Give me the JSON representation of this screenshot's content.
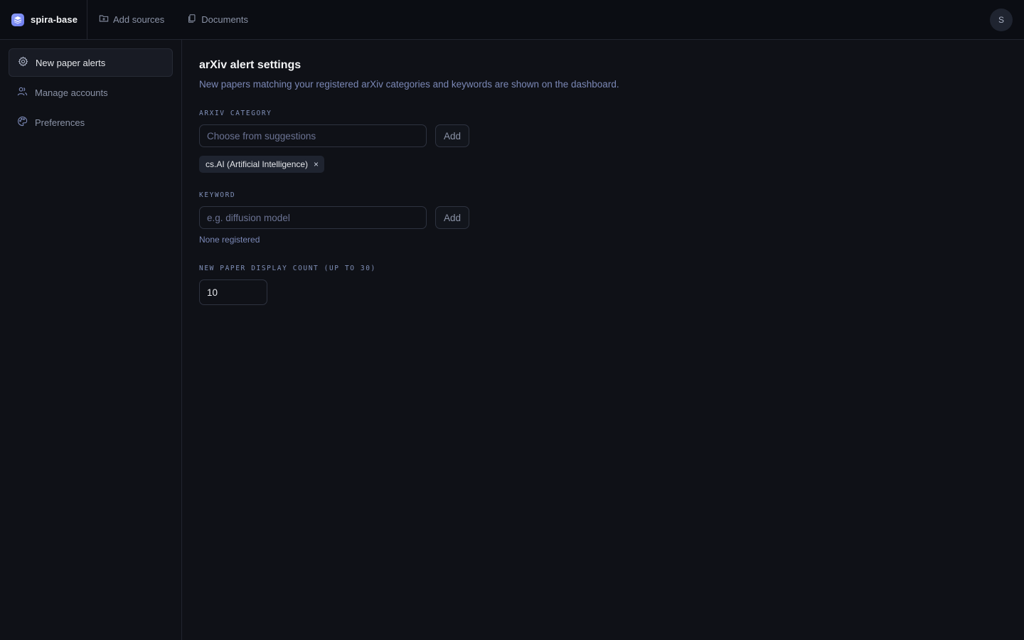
{
  "app": {
    "name": "spira-base"
  },
  "topnav": {
    "items": [
      {
        "label": "Add sources",
        "icon": "folder-plus-icon"
      },
      {
        "label": "Documents",
        "icon": "documents-icon"
      }
    ]
  },
  "user": {
    "initial": "S"
  },
  "sidebar": {
    "items": [
      {
        "label": "New paper alerts",
        "icon": "gear-icon",
        "active": true
      },
      {
        "label": "Manage accounts",
        "icon": "users-icon",
        "active": false
      },
      {
        "label": "Preferences",
        "icon": "palette-icon",
        "active": false
      }
    ]
  },
  "page": {
    "title": "arXiv alert settings",
    "subtitle": "New papers matching your registered arXiv categories and keywords are shown on the dashboard."
  },
  "category": {
    "label": "ARXIV CATEGORY",
    "placeholder": "Choose from suggestions",
    "value": "",
    "add_label": "Add",
    "chips": [
      {
        "label": "cs.AI (Artificial Intelligence)",
        "remove": "×"
      }
    ]
  },
  "keyword": {
    "label": "KEYWORD",
    "placeholder": "e.g. diffusion model",
    "value": "",
    "add_label": "Add",
    "empty_text": "None registered"
  },
  "display_count": {
    "label": "NEW PAPER DISPLAY COUNT (UP TO 30)",
    "value": "10"
  },
  "colors": {
    "background": "#0f1117",
    "topbar": "#0b0d13",
    "accent": "#8b9cf8",
    "muted_text": "#7b88b6"
  }
}
